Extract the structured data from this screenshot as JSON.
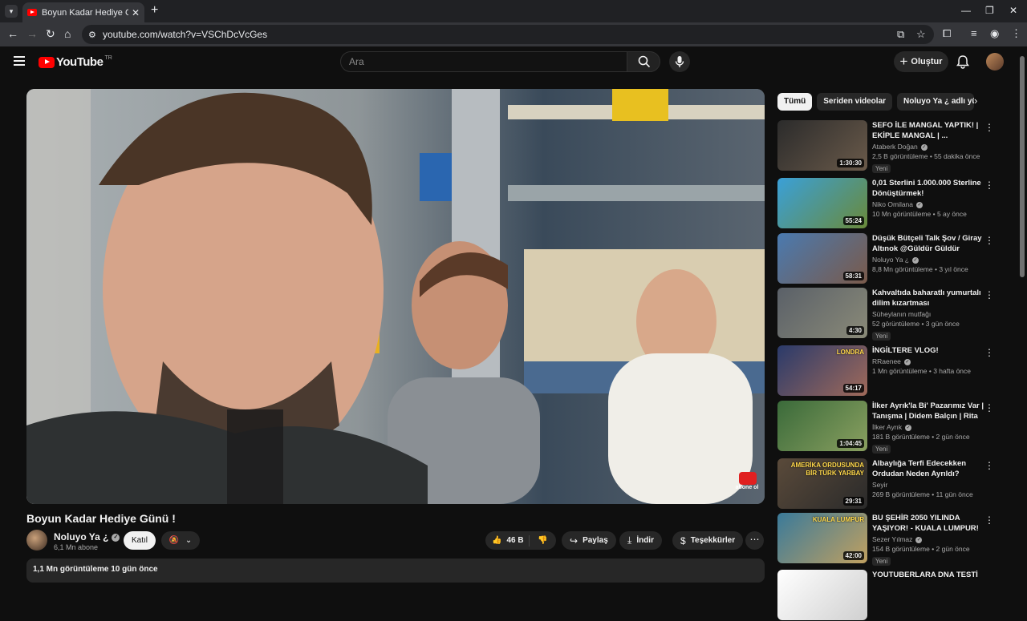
{
  "browser": {
    "tab_title": "Boyun Kadar Hediye Günü ! - YouTube",
    "tab_close": "✕",
    "new_tab": "+",
    "url": "youtube.com/watch?v=VSChDcVcGes"
  },
  "header": {
    "logo": "YouTube",
    "country": "TR",
    "search_placeholder": "Ara",
    "create_label": "Oluştur"
  },
  "video": {
    "title": "Boyun Kadar Hediye Günü !",
    "channel": "Noluyo Ya ¿",
    "subscribers": "6,1 Mn abone",
    "join_label": "Katıl",
    "likes": "46 B",
    "share_label": "Paylaş",
    "download_label": "İndir",
    "thanks_label": "Teşekkürler",
    "description_meta": "1,1 Mn görüntüleme  10 gün önce",
    "watermark": "abone ol"
  },
  "sidebar": {
    "chips": [
      "Tümü",
      "Seriden videolar",
      "Noluyo Ya ¿ adlı yükleyiciden"
    ],
    "recommendations": [
      {
        "title": "SEFO İLE MANGAL YAPTIK! | EKİPLE MANGAL | ...",
        "channel": "Ataberk Doğan",
        "verified": true,
        "views": "2,5 B görüntüleme",
        "age": "55 dakika önce",
        "badge": "Yeni",
        "duration": "1:30:30",
        "thumb_colors": [
          "#2b2b2b",
          "#6a5a4a"
        ]
      },
      {
        "title": "0,01 Sterlini 1.000.000 Sterline Dönüştürmek!",
        "channel": "Niko Omilana",
        "verified": true,
        "views": "10 Mn görüntüleme",
        "age": "5 ay önce",
        "badge": "",
        "duration": "55:24",
        "thumb_colors": [
          "#3aa0d8",
          "#6a8a3a"
        ]
      },
      {
        "title": "Düşük Bütçeli Talk Şov / Giray Altınok @Güldür Güldür",
        "channel": "Noluyo Ya ¿",
        "verified": true,
        "views": "8,8 Mn görüntüleme",
        "age": "3 yıl önce",
        "badge": "",
        "duration": "58:31",
        "thumb_colors": [
          "#4a7ab0",
          "#7a5a4a"
        ]
      },
      {
        "title": "Kahvaltıda baharatlı yumurtalı dilim kızartması",
        "channel": "Süheylanın mutfağı",
        "verified": false,
        "views": "52 görüntüleme",
        "age": "3 gün önce",
        "badge": "Yeni",
        "duration": "4:30",
        "thumb_colors": [
          "#5a6068",
          "#8a8a78"
        ]
      },
      {
        "title": "İNGİLTERE VLOG!",
        "channel": "RRaenee",
        "verified": true,
        "views": "1 Mn görüntüleme",
        "age": "3 hafta önce",
        "badge": "",
        "duration": "54:17",
        "thumb_colors": [
          "#2a3a6a",
          "#a06a5a"
        ]
      },
      {
        "title": "İlker Ayrık'la Bi' Pazarımız Var | Tanışma | Didem Balçın | Rita ...",
        "channel": "İlker Ayrık",
        "verified": true,
        "views": "181 B görüntüleme",
        "age": "2 gün önce",
        "badge": "Yeni",
        "duration": "1:04:45",
        "thumb_colors": [
          "#3a6a3a",
          "#8aa060"
        ]
      },
      {
        "title": "Albaylığa Terfi Edecekken Ordudan Neden Ayrıldı?",
        "channel": "Seyir",
        "verified": false,
        "views": "269 B görüntüleme",
        "age": "11 gün önce",
        "badge": "",
        "duration": "29:31",
        "thumb_colors": [
          "#5a4a3a",
          "#2a2a2a"
        ]
      },
      {
        "title": "BU ŞEHİR 2050 YILINDA YAŞIYOR! - KUALA LUMPUR!",
        "channel": "Sezer Yılmaz",
        "verified": true,
        "views": "154 B görüntüleme",
        "age": "2 gün önce",
        "badge": "Yeni",
        "duration": "42:00",
        "thumb_colors": [
          "#3a7a9a",
          "#c0a060"
        ]
      },
      {
        "title": "YOUTUBERLARA DNA TESTİ",
        "channel": "",
        "verified": false,
        "views": "",
        "age": "",
        "badge": "",
        "duration": "",
        "thumb_colors": [
          "#ffffff",
          "#d0d0d0"
        ]
      }
    ],
    "thumb_labels": [
      "LONDRA",
      "AMERİKA ORDUSUNDA BİR TÜRK YARBAY",
      "KUALA LUMPUR"
    ]
  }
}
